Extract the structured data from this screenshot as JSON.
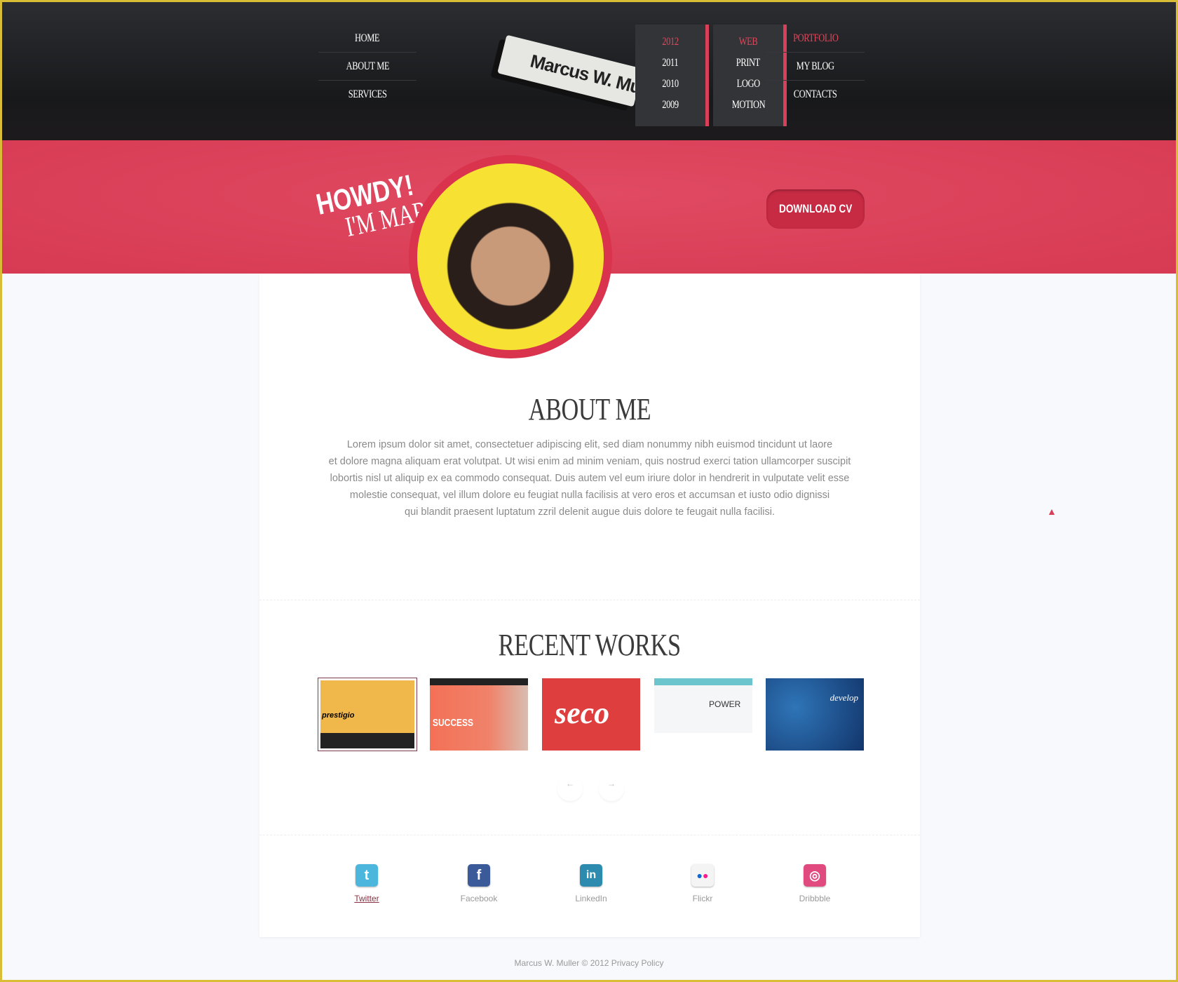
{
  "nav_left": [
    {
      "label": "HOME"
    },
    {
      "label": "ABOUT ME"
    },
    {
      "label": "SERVICES"
    }
  ],
  "logo": {
    "text": "Marcus W. Muller"
  },
  "years_menu": [
    {
      "label": "2012",
      "active": true
    },
    {
      "label": "2011"
    },
    {
      "label": "2010"
    },
    {
      "label": "2009"
    }
  ],
  "portfolio_menu": [
    {
      "label": "WEB",
      "active": true
    },
    {
      "label": "PRINT"
    },
    {
      "label": "LOGO"
    },
    {
      "label": "MOTION"
    }
  ],
  "nav_right": [
    {
      "label": "PORTFOLIO",
      "active": true
    },
    {
      "label": "MY BLOG"
    },
    {
      "label": "CONTACTS"
    }
  ],
  "hero": {
    "line1": "HOWDY!",
    "line2": "I'M MARCUS",
    "download_label": "DOWNLOAD CV"
  },
  "about": {
    "title": "ABOUT ME",
    "lines": [
      "Lorem ipsum dolor sit amet, consectetuer adipiscing elit, sed diam nonummy nibh euismod tincidunt ut laore",
      "et dolore magna aliquam erat volutpat. Ut wisi enim ad minim veniam, quis nostrud exerci tation ullamcorper suscipit",
      "lobortis nisl ut aliquip ex ea commodo consequat. Duis autem vel eum iriure dolor in hendrerit in vulputate velit esse",
      "molestie consequat, vel illum dolore eu feugiat nulla facilisis at vero eros et accumsan et iusto odio dignissi",
      "qui blandit praesent luptatum zzril delenit augue duis dolore te feugait nulla facilisi."
    ]
  },
  "recent": {
    "title": "RECENT WORKS",
    "works": [
      {
        "text": "prestigio"
      },
      {
        "text": "SUCCESS"
      },
      {
        "text": "seco"
      },
      {
        "text": "POWER"
      },
      {
        "text": "develop"
      }
    ],
    "prev": "←",
    "next": "→"
  },
  "social": [
    {
      "label": "Twitter",
      "icon": "twitter-icon",
      "color": "#4cb6dc"
    },
    {
      "label": "Facebook",
      "icon": "facebook-icon",
      "color": "#3b5a9a"
    },
    {
      "label": "LinkedIn",
      "icon": "linkedin-icon",
      "color": "#2e8bb0"
    },
    {
      "label": "Flickr",
      "icon": "flickr-icon",
      "color": "#f2f2f2"
    },
    {
      "label": "Dribbble",
      "icon": "dribbble-icon",
      "color": "#e04a7e"
    }
  ],
  "footer": {
    "text": "Marcus W. Muller © 2012 Privacy Policy"
  },
  "colors": {
    "accent": "#d8405a",
    "header": "#1d1e20",
    "border": "#d9bd36"
  }
}
